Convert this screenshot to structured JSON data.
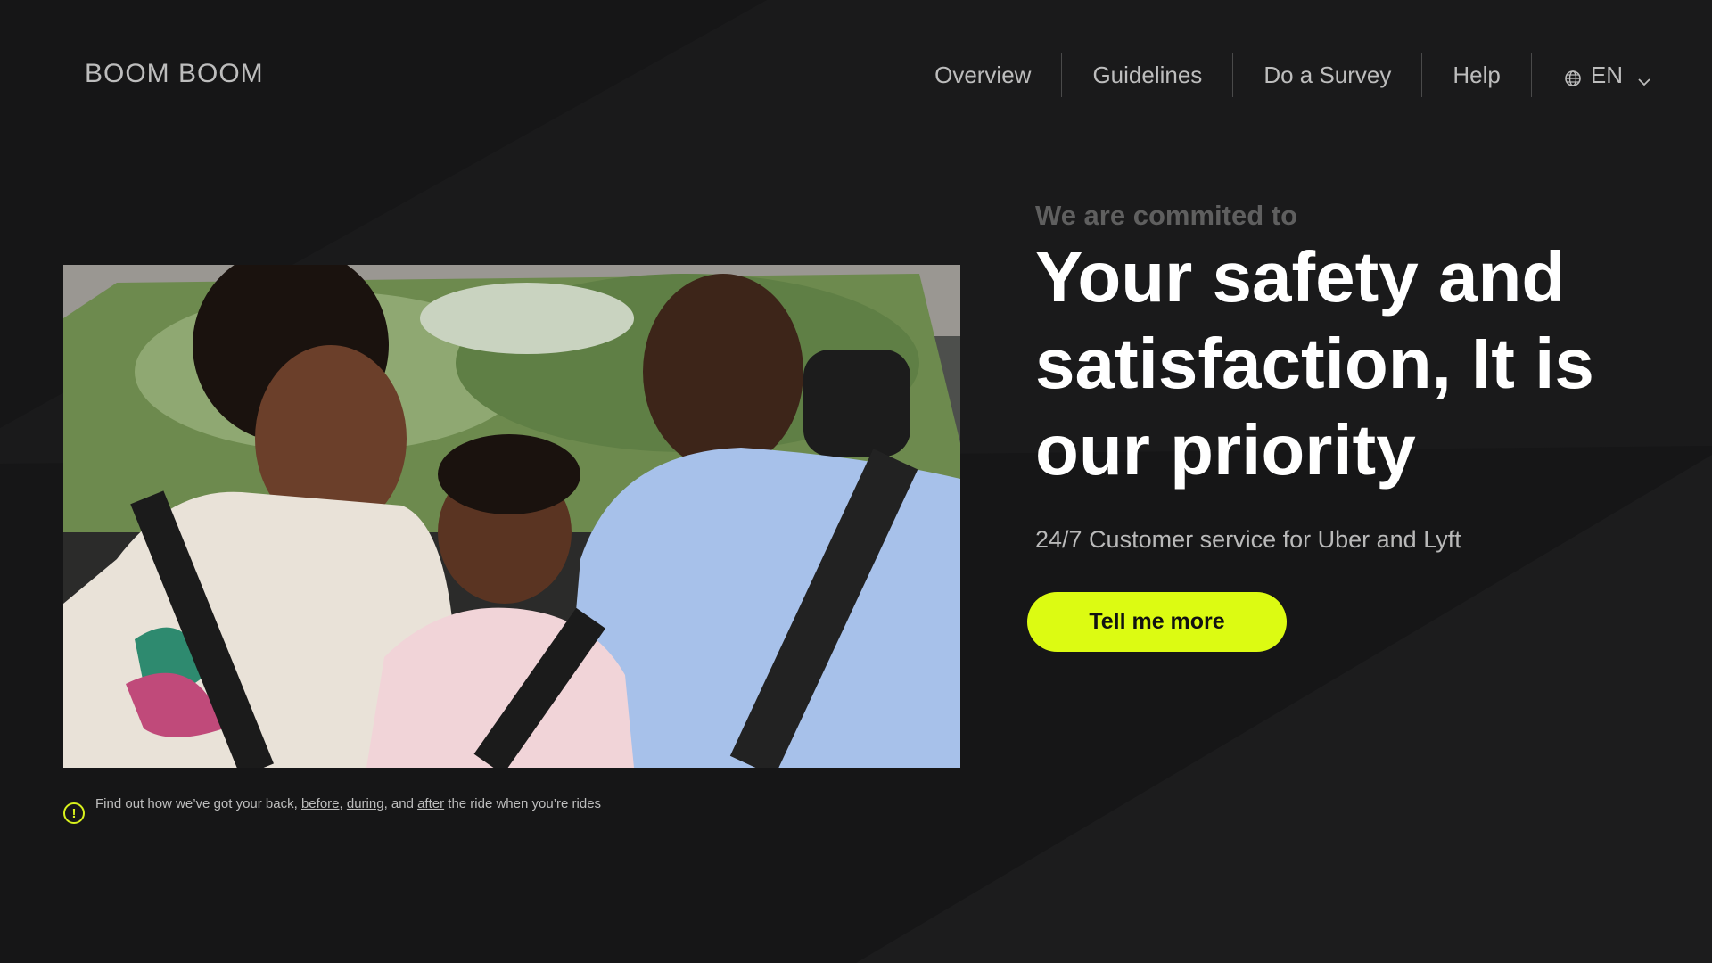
{
  "brand": {
    "logo_text": "BOOM BOOM"
  },
  "nav": {
    "items": [
      {
        "label": "Overview"
      },
      {
        "label": "Guidelines"
      },
      {
        "label": "Do a Survey"
      },
      {
        "label": "Help"
      }
    ],
    "language": {
      "label": "EN",
      "icon": "globe-icon",
      "chevron": "chevron-down-icon"
    }
  },
  "hero": {
    "eyebrow": "We are commited to",
    "headline": "Your safety and satisfaction, It is our priority",
    "subhead": "24/7 Customer service for Uber and Lyft",
    "cta_label": "Tell me more",
    "image_alt": "Family smiling in the back seat of a car"
  },
  "note": {
    "icon": "info-icon",
    "icon_glyph": "!",
    "text_1": "Find out how we’ve got your back, ",
    "link_before": "before",
    "sep_1": ", ",
    "link_during": "during",
    "text_2": ", and ",
    "link_after": "after",
    "text_3": " the ride when you’re rides"
  },
  "colors": {
    "background": "#161617",
    "accent": "#dcfb12",
    "text_primary": "#ffffff",
    "text_secondary": "#bdbdbd",
    "text_muted": "#5f5f5f"
  }
}
